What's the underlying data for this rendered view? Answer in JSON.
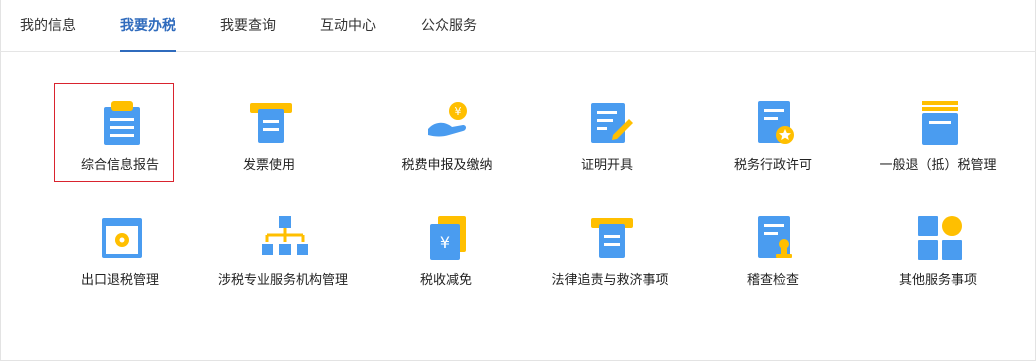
{
  "tabs": [
    {
      "label": "我的信息"
    },
    {
      "label": "我要办税"
    },
    {
      "label": "我要查询"
    },
    {
      "label": "互动中心"
    },
    {
      "label": "公众服务"
    }
  ],
  "active_tab": "我要办税",
  "colors": {
    "accent": "#2f6bbd",
    "icon_blue": "#4a9cf0",
    "icon_yellow": "#ffbf00",
    "selection": "#d9232e"
  },
  "services": [
    {
      "label": "综合信息报告",
      "icon": "clipboard-icon"
    },
    {
      "label": "发票使用",
      "icon": "invoice-printer-icon"
    },
    {
      "label": "税费申报及缴纳",
      "icon": "hand-coin-icon"
    },
    {
      "label": "证明开具",
      "icon": "document-pen-icon"
    },
    {
      "label": "税务行政许可",
      "icon": "document-star-icon"
    },
    {
      "label": "一般退（抵）税管理",
      "icon": "stacked-document-icon"
    },
    {
      "label": "出口退税管理",
      "icon": "window-gear-icon"
    },
    {
      "label": "涉税专业服务机构管理",
      "icon": "org-chart-icon"
    },
    {
      "label": "税收减免",
      "icon": "yuan-document-icon"
    },
    {
      "label": "法律追责与救济事项",
      "icon": "legal-printer-icon"
    },
    {
      "label": "稽查检查",
      "icon": "document-stamp-icon"
    },
    {
      "label": "其他服务事项",
      "icon": "grid-circle-icon"
    }
  ]
}
